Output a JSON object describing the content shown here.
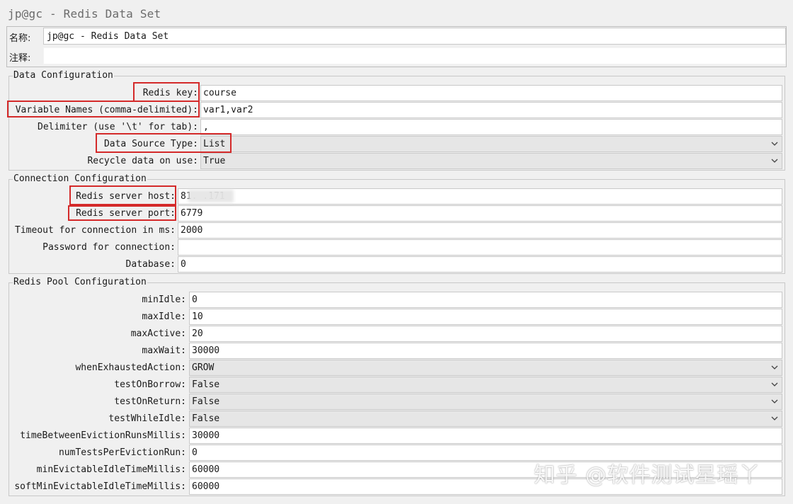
{
  "window": {
    "title": "jp@gc - Redis Data Set"
  },
  "top": {
    "name_label": "名称:",
    "name_value": "jp@gc - Redis Data Set",
    "comment_label": "注释:",
    "comment_value": ""
  },
  "data_config": {
    "legend": "Data Configuration",
    "redis_key_label": "Redis key:",
    "redis_key_value": "course",
    "variable_names_label": "Variable Names (comma-delimited):",
    "variable_names_value": "var1,var2",
    "delimiter_label": "Delimiter (use '\\t' for tab):",
    "delimiter_value": ",",
    "data_source_type_label": "Data Source Type:",
    "data_source_type_value": "List",
    "recycle_label": "Recycle data on use:",
    "recycle_value": "True"
  },
  "connection_config": {
    "legend": "Connection Configuration",
    "host_label": "Redis server host:",
    "host_value": "81.        .171",
    "port_label": "Redis server port:",
    "port_value": "6779",
    "timeout_label": "Timeout for connection in ms:",
    "timeout_value": "2000",
    "password_label": "Password for connection:",
    "password_value": "",
    "database_label": "Database:",
    "database_value": "0"
  },
  "pool_config": {
    "legend": "Redis Pool Configuration",
    "rows": [
      {
        "label": "minIdle:",
        "value": "0",
        "type": "text"
      },
      {
        "label": "maxIdle:",
        "value": "10",
        "type": "text"
      },
      {
        "label": "maxActive:",
        "value": "20",
        "type": "text"
      },
      {
        "label": "maxWait:",
        "value": "30000",
        "type": "text"
      },
      {
        "label": "whenExhaustedAction:",
        "value": "GROW",
        "type": "select"
      },
      {
        "label": "testOnBorrow:",
        "value": "False",
        "type": "select"
      },
      {
        "label": "testOnReturn:",
        "value": "False",
        "type": "select"
      },
      {
        "label": "testWhileIdle:",
        "value": "False",
        "type": "select"
      },
      {
        "label": "timeBetweenEvictionRunsMillis:",
        "value": "30000",
        "type": "text"
      },
      {
        "label": "numTestsPerEvictionRun:",
        "value": "0",
        "type": "text"
      },
      {
        "label": "minEvictableIdleTimeMillis:",
        "value": "60000",
        "type": "text"
      },
      {
        "label": "softMinEvictableIdleTimeMillis:",
        "value": "60000",
        "type": "text"
      }
    ]
  },
  "watermark": "知乎 @软件测试星瑶丫",
  "colors": {
    "highlight": "#d42a2a",
    "panel": "#f0f0f0",
    "field_bg": "#ffffff",
    "select_bg": "#e6e6e6"
  },
  "icons": {
    "dropdown": "chevron-down-icon"
  }
}
